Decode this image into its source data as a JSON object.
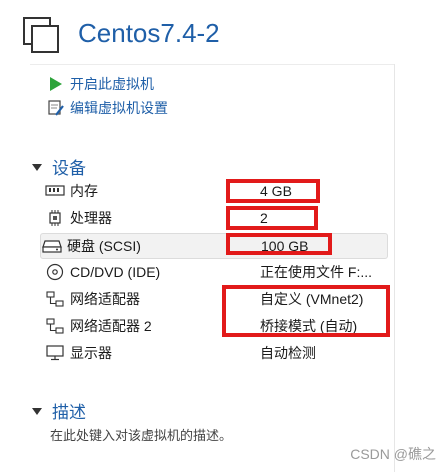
{
  "vm": {
    "title": "Centos7.4-2"
  },
  "actions": [
    {
      "label": "开启此虚拟机",
      "icon": "play-icon"
    },
    {
      "label": "编辑虚拟机设置",
      "icon": "edit-settings-icon"
    }
  ],
  "devices_section": {
    "label": "设备",
    "items": [
      {
        "name": "内存",
        "value": "4 GB",
        "icon": "memory-icon"
      },
      {
        "name": "处理器",
        "value": "2",
        "icon": "cpu-icon"
      },
      {
        "name": "硬盘 (SCSI)",
        "value": "100 GB",
        "icon": "harddisk-icon"
      },
      {
        "name": "CD/DVD (IDE)",
        "value": "正在使用文件 F:...",
        "icon": "cd-icon"
      },
      {
        "name": "网络适配器",
        "value": "自定义 (VMnet2)",
        "icon": "network-icon"
      },
      {
        "name": "网络适配器 2",
        "value": "桥接模式 (自动)",
        "icon": "network-icon"
      },
      {
        "name": "显示器",
        "value": "自动检测",
        "icon": "monitor-icon"
      }
    ]
  },
  "description_section": {
    "label": "描述",
    "placeholder": "在此处键入对该虚拟机的描述。"
  },
  "colors": {
    "accent": "#1f5fa8",
    "highlight_box": "#e21a1a"
  },
  "watermark": "CSDN @礁之"
}
